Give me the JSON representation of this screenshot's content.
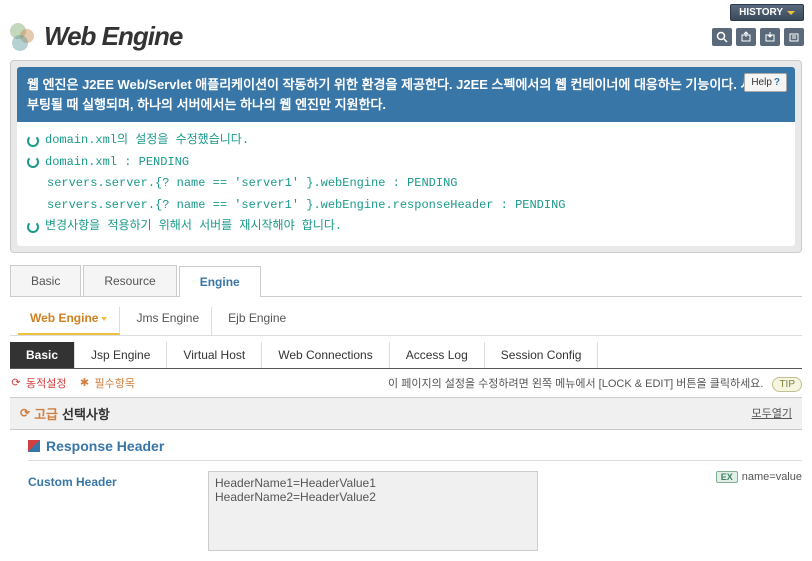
{
  "header": {
    "history_label": "HISTORY",
    "logo_text": "Web Engine"
  },
  "description": {
    "text": "웹 엔진은 J2EE Web/Servlet 애플리케이션이 작동하기 위한 환경을 제공한다. J2EE 스펙에서의 웹 컨테이너에 대응하는 기능이다. 서버가 부팅될 때 실행되며, 하나의 서버에서는 하나의 웹 엔진만 지원한다.",
    "help_label": "Help"
  },
  "pending": {
    "line1": "domain.xml의 설정을 수정했습니다.",
    "line2": "domain.xml : PENDING",
    "line3": "servers.server.{? name == 'server1' }.webEngine : PENDING",
    "line4": "servers.server.{? name == 'server1' }.webEngine.responseHeader : PENDING",
    "line5": "변경사항을 적용하기 위해서 서버를 재시작해야 합니다."
  },
  "tabs_main": {
    "basic": "Basic",
    "resource": "Resource",
    "engine": "Engine"
  },
  "tabs_sub": {
    "web_engine": "Web Engine",
    "jms_engine": "Jms Engine",
    "ejb_engine": "Ejb Engine"
  },
  "tabs_dark": {
    "basic": "Basic",
    "jsp_engine": "Jsp Engine",
    "virtual_host": "Virtual Host",
    "web_connections": "Web Connections",
    "access_log": "Access Log",
    "session_config": "Session Config"
  },
  "legend": {
    "dynamic": "동적설정",
    "required": "필수항목",
    "tip_text": "이 페이지의 설정을 수정하려면 왼쪽 메뉴에서 [LOCK & EDIT] 버튼을 클릭하세요.",
    "tip_badge": "TIP"
  },
  "section": {
    "advanced_label": "고급",
    "options_label": "선택사항",
    "open_all": "모두열기"
  },
  "panel": {
    "title": "Response Header",
    "field_label": "Custom Header",
    "field_value": "HeaderName1=HeaderValue1\nHeaderName2=HeaderValue2",
    "example_badge": "EX",
    "example_text": "name=value"
  }
}
